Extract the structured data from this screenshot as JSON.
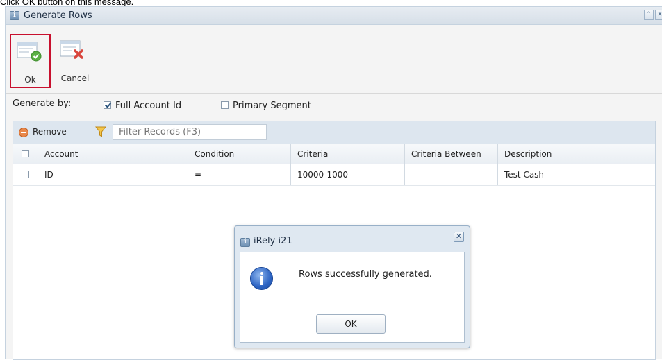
{
  "caption": "Click OK button on this message.",
  "window": {
    "title": "Generate Rows",
    "controls": [
      "collapse-icon",
      "close-icon"
    ]
  },
  "toolbar": {
    "ok_label": "Ok",
    "cancel_label": "Cancel"
  },
  "generate": {
    "label": "Generate by:",
    "options": [
      {
        "label": "Full Account Id",
        "checked": true
      },
      {
        "label": "Primary Segment",
        "checked": false
      }
    ]
  },
  "grid": {
    "remove_label": "Remove",
    "filter_placeholder": "Filter Records (F3)",
    "columns": [
      "Account",
      "Condition",
      "Criteria",
      "Criteria Between",
      "Description"
    ],
    "rows": [
      {
        "account": "ID",
        "condition": "=",
        "criteria": "10000-1000",
        "criteria_between": "",
        "description": "Test Cash"
      }
    ]
  },
  "dialog": {
    "title": "iRely i21",
    "message": "Rows successfully generated.",
    "ok_label": "OK"
  },
  "colors": {
    "highlight": "#c8102e",
    "titlebar": "#dbe3ec",
    "grid_toolbar": "#dde6ef"
  }
}
